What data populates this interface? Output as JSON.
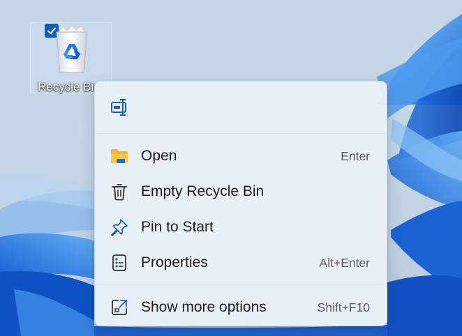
{
  "desktop": {
    "icon": {
      "label": "Recycle Bin",
      "selected": true,
      "icon_name": "recycle-bin-icon"
    }
  },
  "context_menu": {
    "quick_actions": [
      {
        "name": "rename",
        "icon_name": "rename-icon"
      }
    ],
    "items": [
      {
        "label": "Open",
        "shortcut": "Enter",
        "icon_name": "folder-icon"
      },
      {
        "label": "Empty Recycle Bin",
        "shortcut": "",
        "icon_name": "trash-icon"
      },
      {
        "label": "Pin to Start",
        "shortcut": "",
        "icon_name": "pin-icon"
      },
      {
        "label": "Properties",
        "shortcut": "Alt+Enter",
        "icon_name": "properties-icon"
      },
      {
        "label": "Show more options",
        "shortcut": "Shift+F10",
        "icon_name": "show-more-options-icon"
      }
    ]
  },
  "colors": {
    "accent": "#0f5fb6",
    "menu_background": "#ecf3fa",
    "wallpaper_blue": "#1e74e6"
  }
}
